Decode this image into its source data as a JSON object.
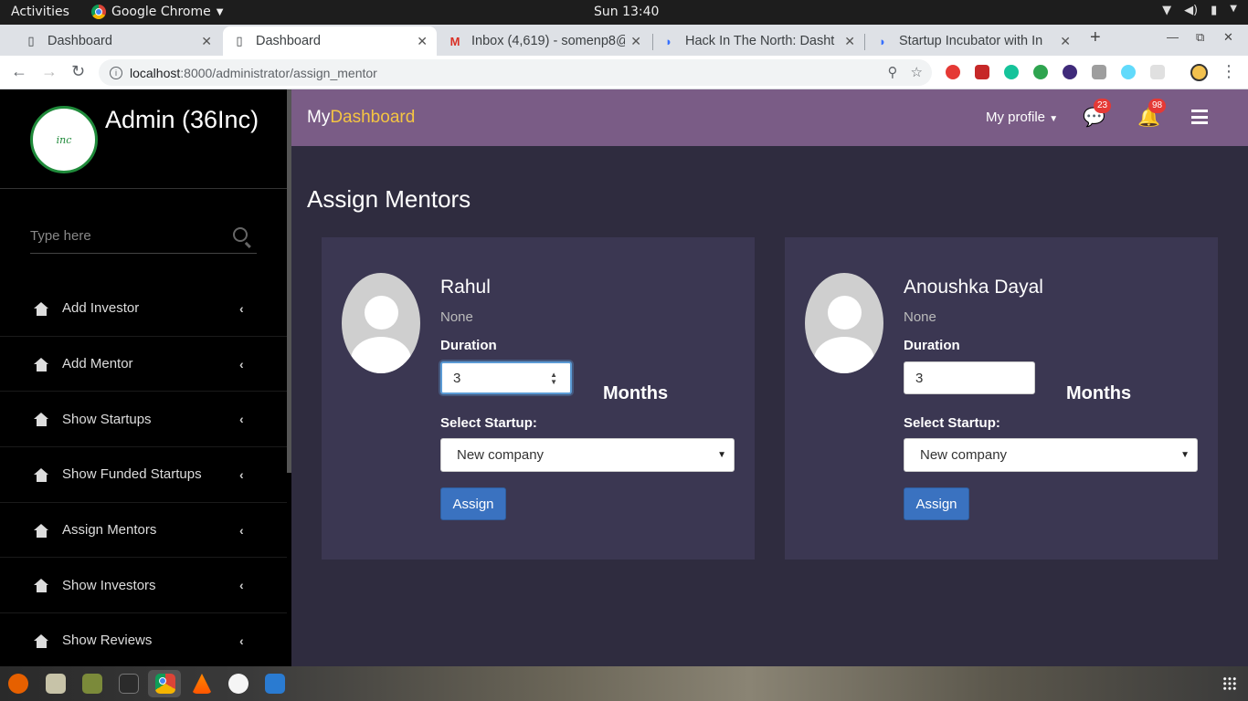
{
  "system": {
    "activities": "Activities",
    "app_name": "Google Chrome",
    "clock": "Sun 13:40"
  },
  "tabs": [
    {
      "title": "Dashboard",
      "icon": "page-icon"
    },
    {
      "title": "Dashboard",
      "icon": "page-icon"
    },
    {
      "title": "Inbox (4,619) - somenp8@",
      "icon": "gmail-icon"
    },
    {
      "title": "Hack In The North: Dasht",
      "icon": "devfolio-icon"
    },
    {
      "title": "Startup Incubator with In",
      "icon": "devfolio-icon"
    }
  ],
  "address": {
    "host": "localhost",
    "path": ":8000/administrator/assign_mentor"
  },
  "sidebar": {
    "title": "Admin (36Inc)",
    "logo_text": "inc",
    "search_placeholder": "Type here",
    "items": [
      {
        "label": "Add Investor"
      },
      {
        "label": "Add Mentor"
      },
      {
        "label": "Show Startups"
      },
      {
        "label": "Show Funded Startups"
      },
      {
        "label": "Assign Mentors"
      },
      {
        "label": "Show Investors"
      },
      {
        "label": "Show Reviews"
      }
    ]
  },
  "header": {
    "brand_prefix": "My",
    "brand_accent": "Dashboard",
    "profile_label": "My profile",
    "messages_count": "23",
    "notifications_count": "98"
  },
  "page": {
    "title": "Assign Mentors"
  },
  "mentors": [
    {
      "name": "Rahul",
      "subtitle": "None",
      "duration_label": "Duration",
      "duration_value": "3",
      "months_label": "Months",
      "startup_label": "Select Startup:",
      "startup_selected": "New company",
      "button": "Assign"
    },
    {
      "name": "Anoushka Dayal",
      "subtitle": "None",
      "duration_label": "Duration",
      "duration_value": "3",
      "months_label": "Months",
      "startup_label": "Select Startup:",
      "startup_selected": "New company",
      "button": "Assign"
    }
  ],
  "colors": {
    "header": "#7a5c86",
    "accent": "#f5c542",
    "content_bg": "#2f2c3f",
    "card_bg": "#3b3752",
    "button": "#3a72c0",
    "badge": "#e53935"
  }
}
